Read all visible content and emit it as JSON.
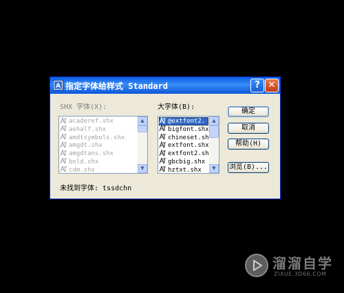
{
  "dialog": {
    "title": "指定字体给样式 Standard",
    "help_label": "?",
    "close_label": "✕"
  },
  "shx_font": {
    "label": "SHX 字体(X):",
    "items": [
      "acaderef.shx",
      "aehalf.shx",
      "amdtsymbols.shx",
      "amgdt.shx",
      "amgdtans.shx",
      "bold.shx",
      "cdm.shx"
    ]
  },
  "big_font": {
    "label": "大字体(B):",
    "items": [
      "@extfont2.",
      "bigfont.shx",
      "chineset.sh",
      "extfont.shx",
      "extfont2.sh",
      "gbcbig.shx",
      "hztxt.shx"
    ],
    "selected_index": 0
  },
  "buttons": {
    "ok": "确定",
    "cancel": "取消",
    "help": "帮助(H)",
    "browse": "浏览(B)..."
  },
  "status": {
    "not_found": "未找到字体: tssdchn"
  },
  "watermark": {
    "title": "溜溜自学",
    "subtitle": "ZIXUE.3D66.COM"
  },
  "colors": {
    "titlebar": "#0a5fe2",
    "dialog_bg": "#ece9d8",
    "selection": "#316ac5",
    "close": "#c43c15"
  }
}
